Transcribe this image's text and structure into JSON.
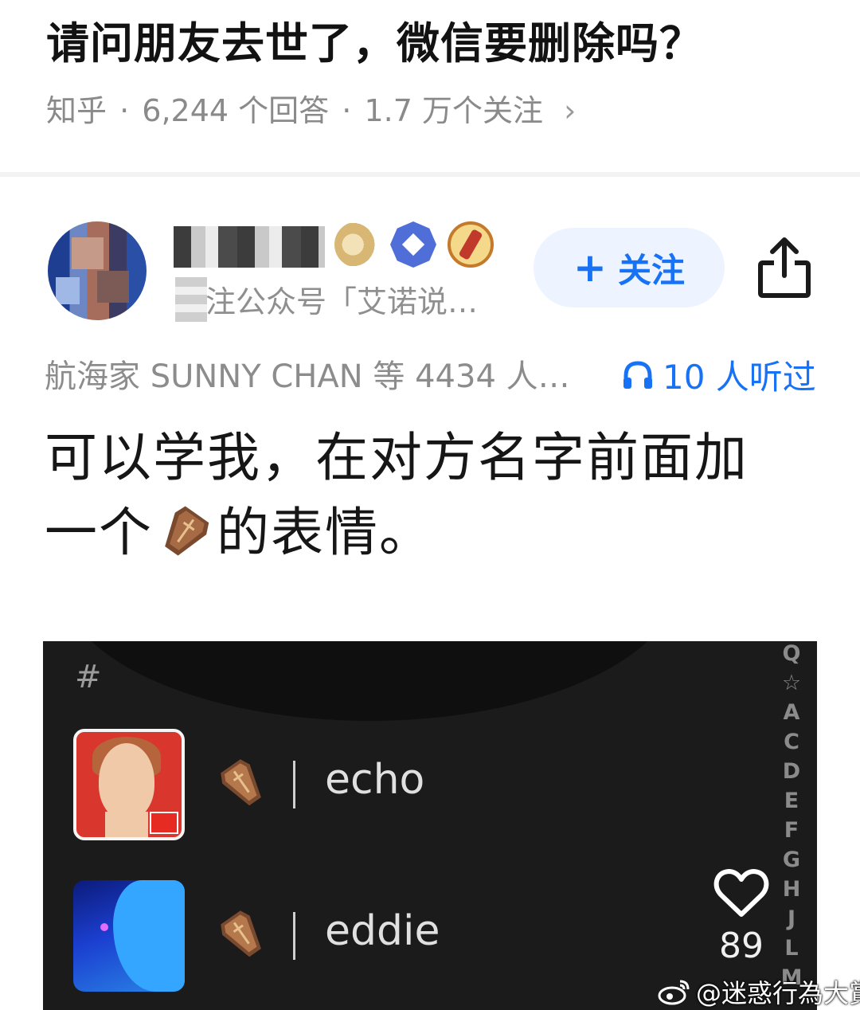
{
  "question": {
    "title": "请问朋友去世了，微信要删除吗？",
    "source": "知乎",
    "answers": "6,244 个回答",
    "followers": "1.7 万个关注",
    "separator": "·",
    "chevron": "›"
  },
  "author": {
    "subtitle": "注公众号「艾诺说…",
    "follow_plus": "+",
    "follow_label": "关注",
    "icons": [
      "avatar",
      "badge-icon",
      "verified-icon",
      "medal-icon",
      "share-icon"
    ]
  },
  "stats": {
    "liked_by": "航海家 SUNNY CHAN 等 4434 人…",
    "listened": "10 人听过",
    "accent": "#1772f6"
  },
  "answer": {
    "line1": "可以学我，在对方名字前面加",
    "line2_pre": "一个",
    "line2_post": "的表情。"
  },
  "embedded_screenshot": {
    "section_header": "#",
    "contacts": [
      {
        "name": "echo",
        "icon": "coffin-icon"
      },
      {
        "name": "eddie",
        "icon": "coffin-icon"
      }
    ],
    "index_letters": [
      "Q",
      "☆",
      "A",
      "C",
      "D",
      "E",
      "F",
      "G",
      "H",
      "J",
      "L",
      "M"
    ],
    "like_count": "89"
  },
  "watermark": "@迷惑行為大賞"
}
